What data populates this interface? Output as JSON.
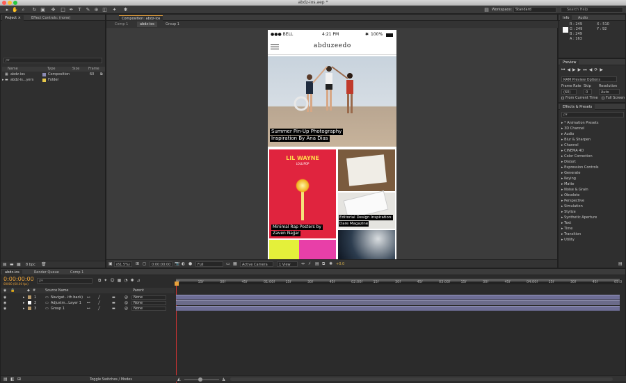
{
  "window": {
    "title": "abdz-ios.aep *"
  },
  "toolbar": {
    "workspace_label": "Workspace:",
    "workspace_value": "Standard",
    "search_placeholder": "Search Help"
  },
  "project_panel": {
    "tab": "Project ×",
    "tab2": "Effect Controls: (none)",
    "search_placeholder": "ρ▾",
    "columns": [
      "Name",
      "Type",
      "Size",
      "Frame"
    ],
    "items": [
      {
        "name": "abdz-ios",
        "type": "Composition",
        "size": "",
        "frame": "60",
        "color": "#8b8bb5"
      },
      {
        "name": "abdz-is...yers",
        "type": "Folder",
        "size": "",
        "frame": "",
        "color": "#e6c84a"
      }
    ],
    "bpc": "8 bpc"
  },
  "comp_panel": {
    "tab": "Composition: abdz-ios",
    "breadcrumbs": [
      "Comp 1",
      "abdz-ios",
      "Group 1"
    ],
    "zoom": "(61.5%)",
    "timecode": "0:00:00:00",
    "resolution": "Full",
    "camera": "Active Camera",
    "views": "1 View",
    "exposure": "+0.0"
  },
  "phone": {
    "carrier": "●●● BELL",
    "time": "4:21 PM",
    "battery": "100%",
    "logo": "abduzeedo",
    "hero_caption_1": "Summer Pin-Up Photography",
    "hero_caption_2": "Inspiration By Ana Dias",
    "poster_title": "LIL WAYNE",
    "poster_sub": "LOLLIPOP",
    "tile1_caption_1": "Minimal Rap Posters by",
    "tile1_caption_2": "Zaven Najjar",
    "tile2_caption_1": "Editorial Design Inspiration:",
    "tile2_caption_2": "Dare Magazine"
  },
  "info_panel": {
    "tab": "Info",
    "tab2": "Audio",
    "r": "R : 249",
    "g": "G : 249",
    "b": "B : 249",
    "a": "A : 163",
    "x": "X : 510",
    "y": "Y : 92"
  },
  "preview_panel": {
    "tab": "Preview",
    "ram_options": "RAM Preview Options",
    "frame_rate_label": "Frame Rate",
    "skip_label": "Skip",
    "resolution_label": "Resolution",
    "frame_rate": "(60)",
    "skip": "0",
    "resolution": "Auto",
    "from_current": "From Current Time",
    "full_screen": "Full Screen"
  },
  "effects_panel": {
    "tab": "Effects & Presets",
    "search_placeholder": "ρ▾",
    "items": [
      "* Animation Presets",
      "3D Channel",
      "Audio",
      "Blur & Sharpen",
      "Channel",
      "CINEMA 4D",
      "Color Correction",
      "Distort",
      "Expression Controls",
      "Generate",
      "Keying",
      "Matte",
      "Noise & Grain",
      "Obsolete",
      "Perspective",
      "Simulation",
      "Stylize",
      "Synthetic Aperture",
      "Text",
      "Time",
      "Transition",
      "Utility"
    ]
  },
  "timeline": {
    "tabs": [
      "abdz-ios",
      "Render Queue",
      "Comp 1"
    ],
    "timecode": "0:00:00:00",
    "fps": "00000 (60.00 fps)",
    "search_placeholder": "ρ▾",
    "col_source": "Source Name",
    "col_parent": "Parent",
    "layers": [
      {
        "num": "1",
        "name": "Navigat...ith back)",
        "parent": "None",
        "color": "#b89a6c"
      },
      {
        "num": "2",
        "name": "Adjustm...Layer 1",
        "parent": "None",
        "color": "#ffffff"
      },
      {
        "num": "3",
        "name": "Group 1",
        "parent": "None",
        "color": "#b89a6c"
      }
    ],
    "ruler": [
      "0f",
      "15f",
      "30f",
      "45f",
      "01:00f",
      "15f",
      "30f",
      "45f",
      "02:00f",
      "15f",
      "30f",
      "45f",
      "03:00f",
      "15f",
      "30f",
      "45f",
      "04:00f",
      "15f",
      "30f",
      "45f",
      "05:0"
    ],
    "footer": "Toggle Switches / Modes"
  },
  "colors": {
    "accent": "#e8a13a",
    "bg": "#2d2d2d",
    "panel": "#2f2f2f"
  }
}
